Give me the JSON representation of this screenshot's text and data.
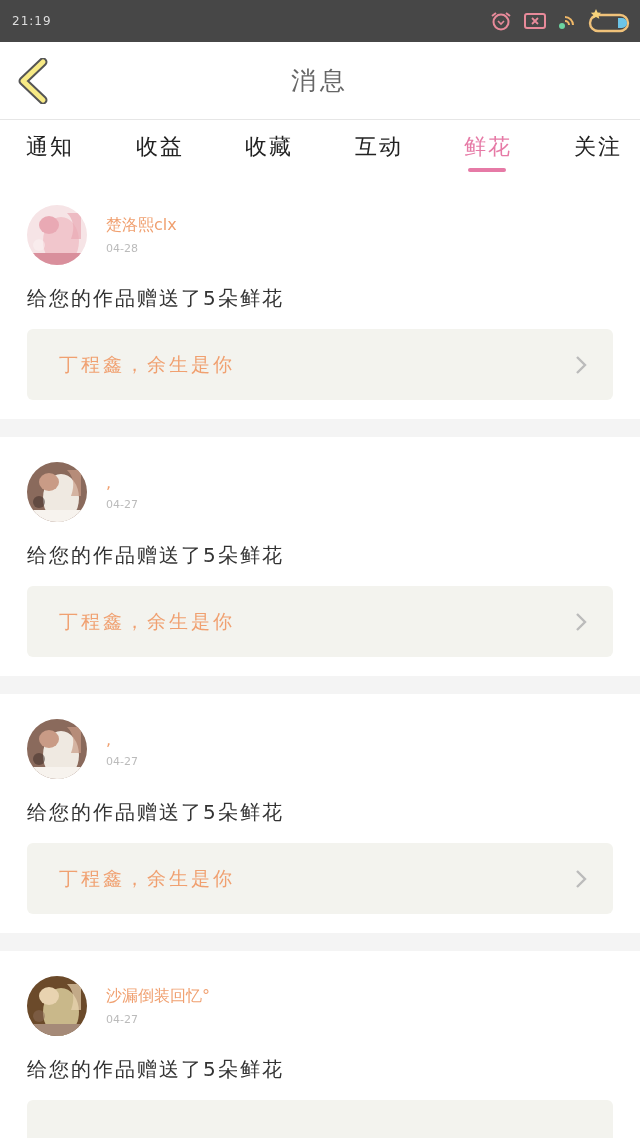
{
  "status_bar": {
    "time": "21:19"
  },
  "header": {
    "title": "消息"
  },
  "tabs": [
    {
      "label": "通知",
      "selected": false
    },
    {
      "label": "收益",
      "selected": false
    },
    {
      "label": "收藏",
      "selected": false
    },
    {
      "label": "互动",
      "selected": false
    },
    {
      "label": "鲜花",
      "selected": true
    },
    {
      "label": "关注",
      "selected": false
    }
  ],
  "messages": [
    {
      "name": "楚洛熙clx",
      "date": "04-28",
      "text": "给您的作品赠送了5朵鲜花",
      "work": "丁程鑫，余生是你"
    },
    {
      "name": ",",
      "date": "04-27",
      "text": "给您的作品赠送了5朵鲜花",
      "work": "丁程鑫，余生是你"
    },
    {
      "name": ",",
      "date": "04-27",
      "text": "给您的作品赠送了5朵鲜花",
      "work": "丁程鑫，余生是你"
    },
    {
      "name": "沙漏倒装回忆°",
      "date": "04-27",
      "text": "给您的作品赠送了5朵鲜花"
    }
  ]
}
